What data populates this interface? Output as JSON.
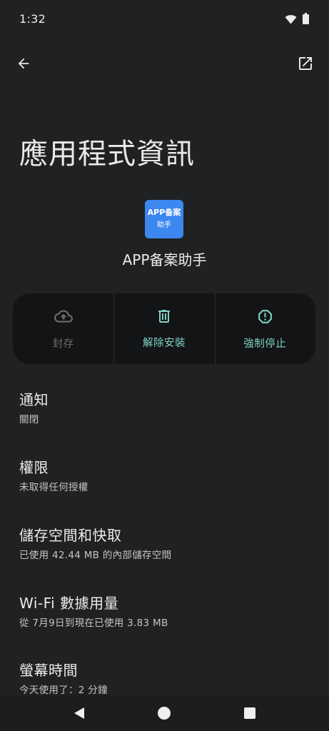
{
  "status_bar": {
    "time": "1:32",
    "icons": [
      "wifi-icon",
      "battery-icon"
    ]
  },
  "toolbar": {
    "back_icon": "arrow-back-icon",
    "open_icon": "open-in-new-icon"
  },
  "page_title": "應用程式資訊",
  "app": {
    "icon_line1": "APP备案",
    "icon_line2": "助手",
    "icon_color": "#3d87f0",
    "name": "APP备案助手"
  },
  "actions": [
    {
      "label": "封存",
      "icon": "cloud-upload-icon",
      "enabled": false
    },
    {
      "label": "解除安裝",
      "icon": "trash-icon",
      "enabled": true
    },
    {
      "label": "強制停止",
      "icon": "alert-octagon-icon",
      "enabled": true
    }
  ],
  "accent_color": "#7fd2c6",
  "settings": [
    {
      "title": "通知",
      "summary": "關閉"
    },
    {
      "title": "權限",
      "summary": "未取得任何授權"
    },
    {
      "title": "儲存空間和快取",
      "summary": "已使用 42.44 MB 的內部儲存空間"
    },
    {
      "title": "Wi-Fi 數據用量",
      "summary": "從 7月9日到現在已使用 3.83 MB"
    },
    {
      "title": "螢幕時間",
      "summary": "今天使用了：2 分鐘"
    }
  ],
  "nav_bar": {
    "back": "nav-back-icon",
    "home": "nav-home-icon",
    "recents": "nav-recents-icon"
  }
}
